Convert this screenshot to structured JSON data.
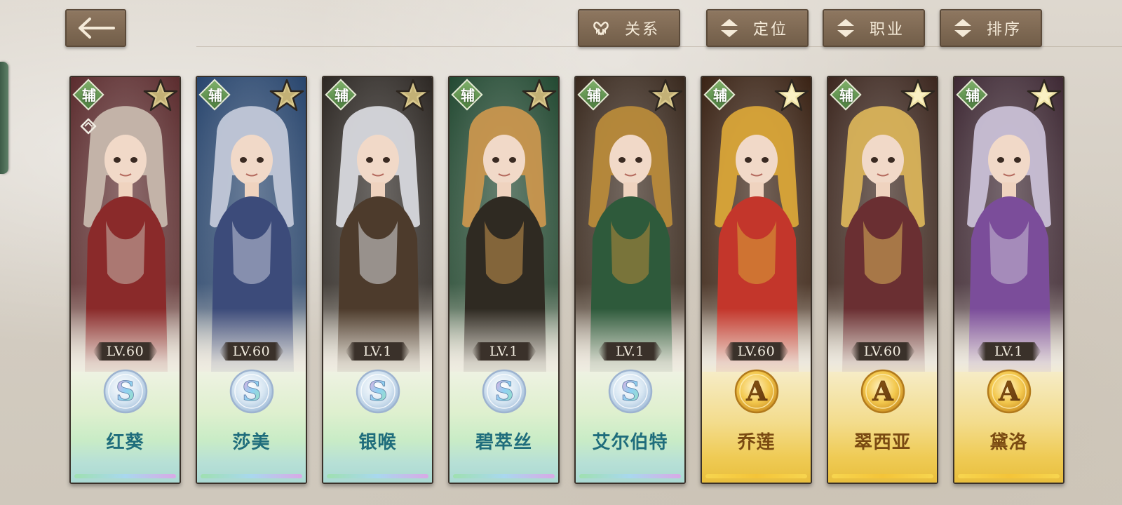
{
  "toolbar": {
    "back_icon": "left-arrow-icon",
    "buttons": [
      {
        "label": "关系",
        "icon": "heart-hands-icon"
      },
      {
        "label": "定位",
        "icon": "sort-updown-icon"
      },
      {
        "label": "职业",
        "icon": "sort-updown-icon"
      },
      {
        "label": "排序",
        "icon": "sort-updown-icon"
      }
    ]
  },
  "colors": {
    "button_bg": "#7f6a54",
    "s_rank_name": "#1f6d7c",
    "a_rank_name": "#7a4a12",
    "role_badge": "#5f9250",
    "side_tab": "#4b6b53"
  },
  "cards": [
    {
      "name": "红葵",
      "level": "LV.60",
      "rank": "S",
      "role": "辅",
      "portrait_colors": [
        "#5c2d2f",
        "#c7b8ad",
        "#8a2a2a"
      ]
    },
    {
      "name": "莎美",
      "level": "LV.60",
      "rank": "S",
      "role": "辅",
      "portrait_colors": [
        "#29466e",
        "#c2c8d8",
        "#3c4b7a"
      ]
    },
    {
      "name": "银喉",
      "level": "LV.1",
      "rank": "S",
      "role": "辅",
      "portrait_colors": [
        "#2e2925",
        "#d7d8dd",
        "#4d3b2c"
      ]
    },
    {
      "name": "碧萃丝",
      "level": "LV.1",
      "rank": "S",
      "role": "辅",
      "portrait_colors": [
        "#244a33",
        "#c9964e",
        "#2f2a22"
      ]
    },
    {
      "name": "艾尔伯特",
      "level": "LV.1",
      "rank": "S",
      "role": "辅",
      "portrait_colors": [
        "#3a2a1f",
        "#b88a3a",
        "#2e5a3b"
      ]
    },
    {
      "name": "乔莲",
      "level": "LV.60",
      "rank": "A",
      "role": "辅",
      "portrait_colors": [
        "#3b2416",
        "#d9a538",
        "#c3362b"
      ]
    },
    {
      "name": "翠西亚",
      "level": "LV.60",
      "rank": "A",
      "role": "辅",
      "portrait_colors": [
        "#3d2820",
        "#d9b35a",
        "#6a2f32"
      ]
    },
    {
      "name": "黛洛",
      "level": "LV.1",
      "rank": "A",
      "role": "辅",
      "portrait_colors": [
        "#3f2a35",
        "#c9c0d6",
        "#7b4d9a"
      ]
    }
  ]
}
